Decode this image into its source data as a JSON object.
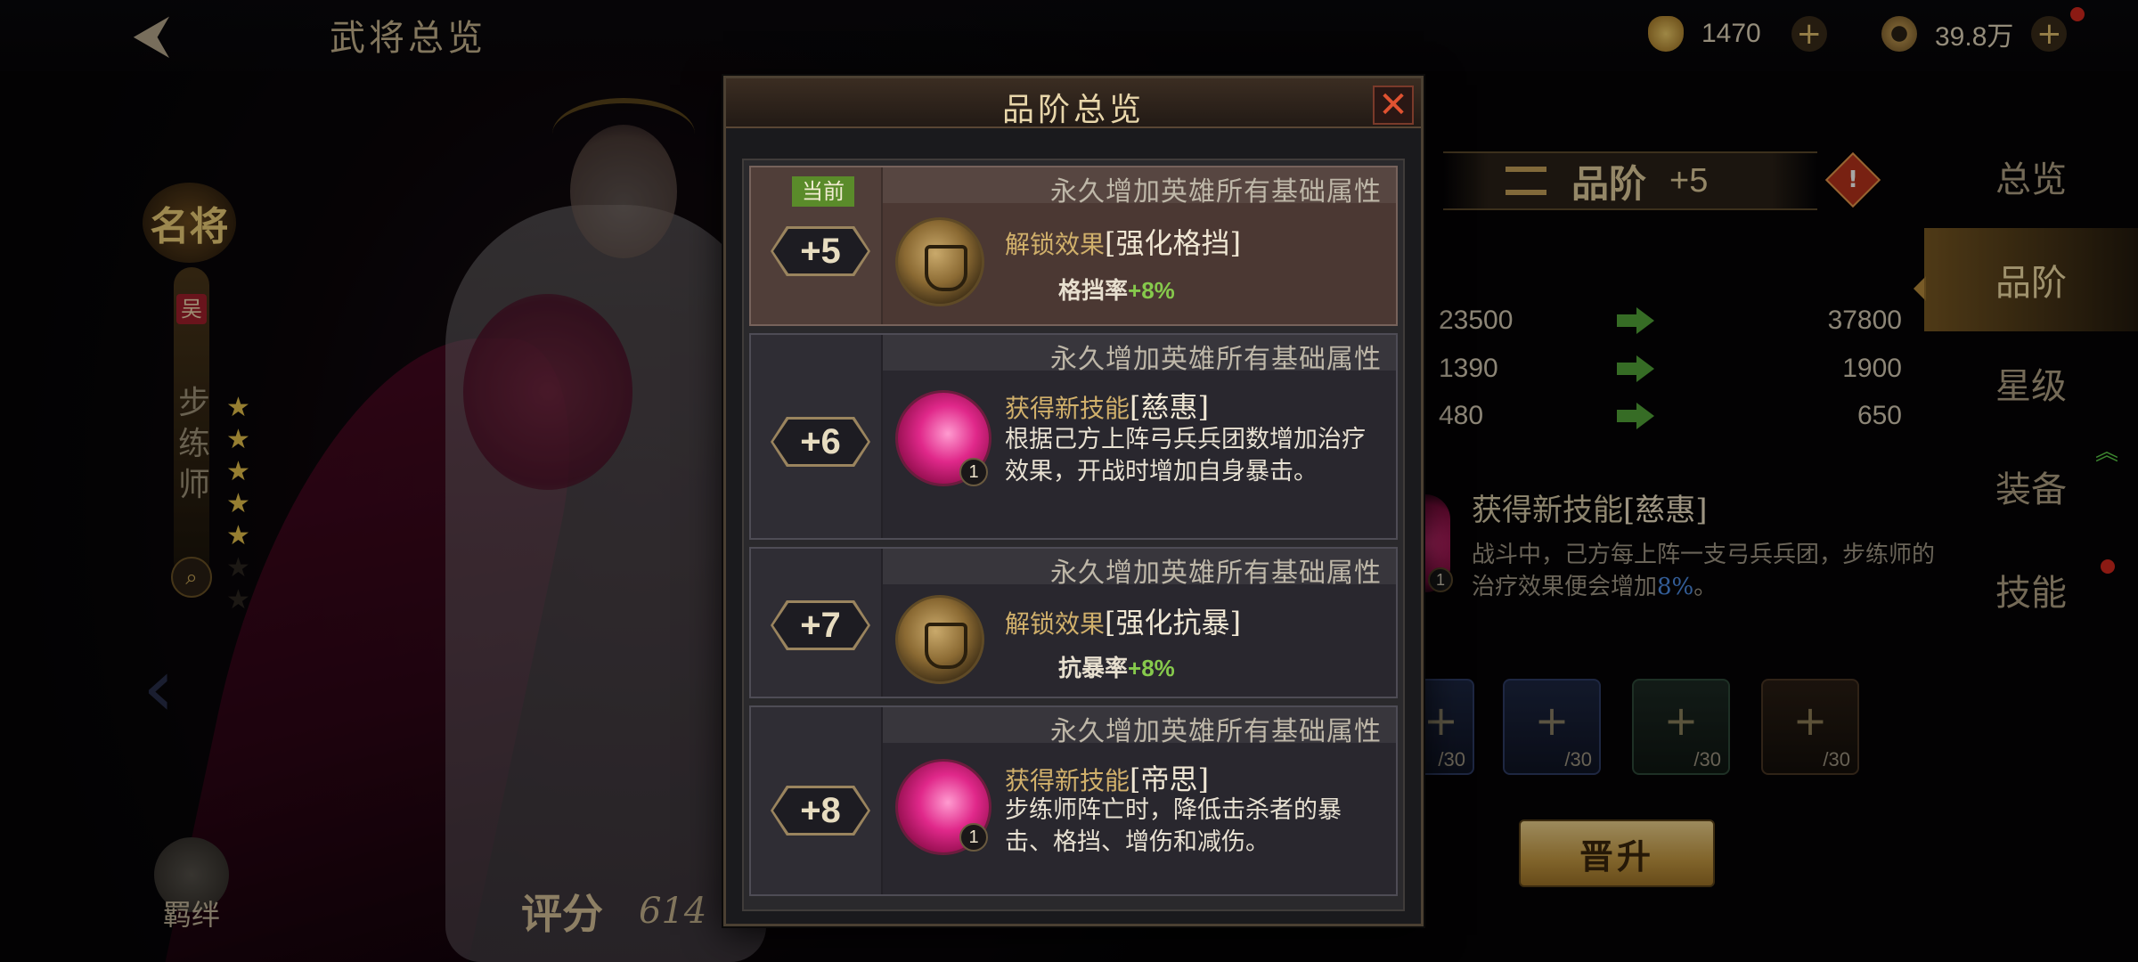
{
  "topbar": {
    "title": "武将总览",
    "gold": "1470",
    "coins": "39.8万"
  },
  "hero": {
    "rank_badge": "名将",
    "faction": "吴",
    "class_name": "步练师",
    "stars_lit": 5,
    "stars_total": 7,
    "bond_label": "羁绊",
    "score_label": "评分",
    "score_value": "614"
  },
  "right_panel": {
    "grade_label": "品阶",
    "grade_value": "+5",
    "warn": "!",
    "stats": [
      {
        "from": "23500",
        "to": "37800"
      },
      {
        "from": "1390",
        "to": "1900"
      },
      {
        "from": "480",
        "to": "650"
      }
    ],
    "skill_preview": {
      "prefix": "获得新技能",
      "name": "[慈惠]",
      "desc_part1": "战斗中，己方每上阵一支弓兵兵团，步练师的治疗效果便会增加",
      "desc_highlight": "8%",
      "desc_part2": "。",
      "level": "1"
    },
    "items": [
      {
        "count": "/30"
      },
      {
        "count": "/30"
      },
      {
        "count": "/30"
      },
      {
        "count": "/30"
      }
    ],
    "promote_label": "晋升"
  },
  "right_nav": {
    "items": [
      "总览",
      "品阶",
      "星级",
      "装备",
      "技能"
    ],
    "active_index": 1
  },
  "modal": {
    "title": "品阶总览",
    "current_tag": "当前",
    "cards": [
      {
        "grade": "+5",
        "header": "永久增加英雄所有基础属性",
        "key": "解锁效果",
        "name": "[强化格挡]",
        "stat_label": "格挡率",
        "stat_value": "+8%"
      },
      {
        "grade": "+6",
        "header": "永久增加英雄所有基础属性",
        "key": "获得新技能",
        "name": "[慈惠]",
        "desc": "根据己方上阵弓兵兵团数增加治疗效果，开战时增加自身暴击。",
        "level": "1"
      },
      {
        "grade": "+7",
        "header": "永久增加英雄所有基础属性",
        "key": "解锁效果",
        "name": "[强化抗暴]",
        "stat_label": "抗暴率",
        "stat_value": "+8%"
      },
      {
        "grade": "+8",
        "header": "永久增加英雄所有基础属性",
        "key": "获得新技能",
        "name": "[帝思]",
        "desc": "步练师阵亡时，降低击杀者的暴击、格挡、增伤和减伤。",
        "level": "1"
      }
    ]
  },
  "colors": {
    "accent_gold": "#e3cf9f",
    "stat_green": "#86c94c",
    "highlight_blue": "#4f8fe8",
    "close_red": "#e05231"
  }
}
